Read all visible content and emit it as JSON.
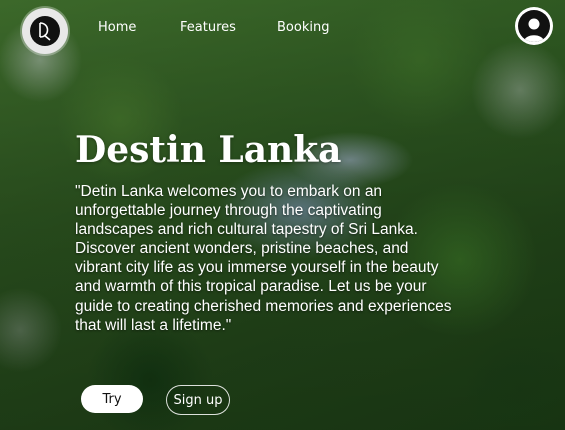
{
  "header": {
    "logo_icon": "destin-lanka-logo-icon",
    "nav": [
      "Home",
      "Features",
      "Booking"
    ],
    "avatar_icon": "user-avatar-icon"
  },
  "hero": {
    "title": "Destin Lanka",
    "description": "\"Detin Lanka welcomes you to embark on an unforgettable journey through the captivating landscapes and rich cultural tapestry of Sri Lanka. Discover ancient wonders, pristine beaches, and vibrant city life as you immerse yourself in the beauty and warmth of this tropical paradise. Let us be your guide to creating cherished memories and experiences that will last a lifetime.\"",
    "background": "aerial-forest-lake-photo"
  },
  "buttons": {
    "try": "Try",
    "signup": "Sign up"
  },
  "colors": {
    "text": "#ffffff",
    "primary_button_bg": "#ffffff",
    "primary_button_text": "#111111"
  }
}
